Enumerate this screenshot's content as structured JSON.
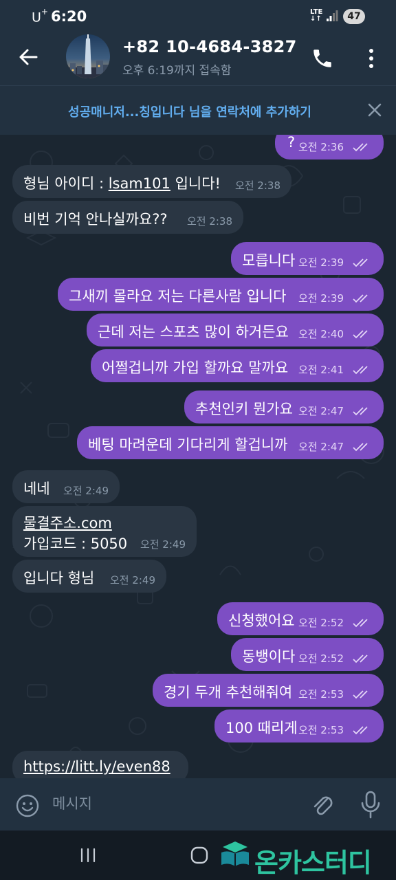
{
  "status_bar": {
    "carrier": "U",
    "carrier_sup": "+",
    "time": "6:20",
    "network": "LTE",
    "battery": "47"
  },
  "header": {
    "contact_name": "+82 10-4684-3827",
    "last_seen": "오후 6:19까지 접속함"
  },
  "add_contact_bar": {
    "text": "성공매니저...칭입니다 님을 연락처에 추가하기"
  },
  "messages": [
    {
      "dir": "out",
      "text": "?",
      "time": "오전 2:36"
    },
    {
      "dir": "in",
      "text_before": "형님 아이디 : ",
      "text_underlined": "lsam101",
      "text_after": " 입니다!",
      "time": "오전 2:38"
    },
    {
      "dir": "in",
      "text": "비번 기억 안나실까요??",
      "time": "오전 2:38"
    },
    {
      "dir": "out",
      "text": "모릅니다",
      "time": "오전 2:39"
    },
    {
      "dir": "out",
      "text": "그새끼 몰라요 저는 다른사람 입니다",
      "time": "오전 2:39"
    },
    {
      "dir": "out",
      "text": "근데 저는 스포츠 많이 하거든요",
      "time": "오전 2:40"
    },
    {
      "dir": "out",
      "text": "어쩔겁니까 가입 할까요 말까요",
      "time": "오전 2:41"
    },
    {
      "dir": "out",
      "text": "추천인키 뭔가요",
      "time": "오전 2:47"
    },
    {
      "dir": "out",
      "text": "베팅 마려운데 기다리게 할겁니까",
      "time": "오전 2:47"
    },
    {
      "dir": "in",
      "text": "네네",
      "time": "오전 2:49"
    },
    {
      "dir": "in",
      "link": "물결주소.com",
      "text": "가입코드 : 5050",
      "time": "오전 2:49"
    },
    {
      "dir": "in",
      "text": "입니다 형님",
      "time": "오전 2:49"
    },
    {
      "dir": "out",
      "text": "신청했어요",
      "time": "오전 2:52"
    },
    {
      "dir": "out",
      "text": "동뱅이다",
      "time": "오전 2:52"
    },
    {
      "dir": "out",
      "text": "경기 두개 추천해줘여",
      "time": "오전 2:53"
    },
    {
      "dir": "out",
      "text": "100 때리게",
      "time": "오전 2:53"
    },
    {
      "dir": "in",
      "link": "https://litt.ly/even88"
    }
  ],
  "composer": {
    "placeholder": "메시지"
  },
  "watermark": {
    "text": "온카스터디"
  },
  "icons": {
    "back": "arrow-left-icon",
    "call": "phone-icon",
    "more": "more-vertical-icon",
    "close": "close-icon",
    "emoji": "emoji-icon",
    "attach": "paperclip-icon",
    "mic": "microphone-icon",
    "nav_recent": "recent-apps-icon",
    "nav_home": "home-icon",
    "read": "double-check-icon"
  },
  "colors": {
    "outgoing_bubble": "#7d4ec4",
    "incoming_bubble": "#2a3643",
    "header": "#223140",
    "link": "#6ab5f2",
    "background": "#1b2631"
  }
}
